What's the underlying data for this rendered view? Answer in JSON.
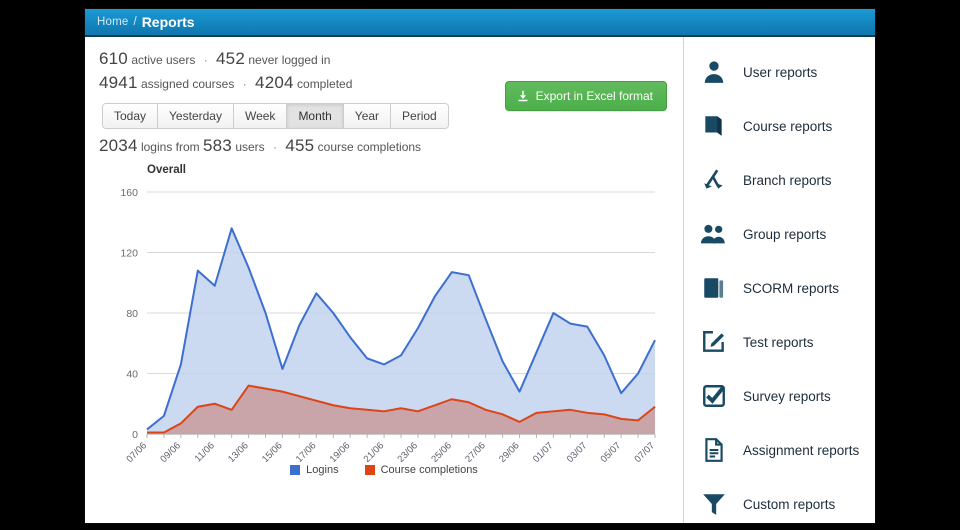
{
  "breadcrumb": {
    "home": "Home",
    "separator": "/",
    "current": "Reports"
  },
  "stats": {
    "line1": {
      "n1": "610",
      "t1": "active users",
      "sep": "·",
      "n2": "452",
      "t2": "never logged in"
    },
    "line2": {
      "n1": "4941",
      "t1": "assigned courses",
      "sep": "·",
      "n2": "4204",
      "t2": "completed"
    },
    "line3": {
      "n1": "2034",
      "t1": "logins from",
      "n2": "583",
      "t2": "users",
      "sep": "·",
      "n3": "455",
      "t3": "course completions"
    }
  },
  "export_button": {
    "label": "Export in Excel format",
    "icon": "download-icon",
    "color": "#4caf4a"
  },
  "tabs": [
    {
      "label": "Today",
      "active": false
    },
    {
      "label": "Yesterday",
      "active": false
    },
    {
      "label": "Week",
      "active": false
    },
    {
      "label": "Month",
      "active": true
    },
    {
      "label": "Year",
      "active": false
    },
    {
      "label": "Period",
      "active": false
    }
  ],
  "sidebar": {
    "items": [
      {
        "label": "User reports",
        "icon": "user-icon"
      },
      {
        "label": "Course reports",
        "icon": "book-icon"
      },
      {
        "label": "Branch reports",
        "icon": "branch-icon"
      },
      {
        "label": "Group reports",
        "icon": "users-group-icon"
      },
      {
        "label": "SCORM reports",
        "icon": "scorm-stack-icon"
      },
      {
        "label": "Test reports",
        "icon": "pencil-square-icon"
      },
      {
        "label": "Survey reports",
        "icon": "check-square-icon"
      },
      {
        "label": "Assignment reports",
        "icon": "document-icon"
      },
      {
        "label": "Custom reports",
        "icon": "funnel-icon"
      }
    ]
  },
  "chart_data": {
    "type": "area",
    "title": "Overall",
    "xlabel": "",
    "ylabel": "",
    "ylim": [
      0,
      160
    ],
    "yticks": [
      0,
      40,
      80,
      120,
      160
    ],
    "grid": true,
    "legend_position": "bottom",
    "x": [
      "07/06",
      "08/06",
      "09/06",
      "10/06",
      "11/06",
      "12/06",
      "13/06",
      "14/06",
      "15/06",
      "16/06",
      "17/06",
      "18/06",
      "19/06",
      "20/06",
      "21/06",
      "22/06",
      "23/06",
      "24/06",
      "25/06",
      "26/06",
      "27/06",
      "28/06",
      "29/06",
      "30/06",
      "01/07",
      "02/07",
      "03/07",
      "04/07",
      "05/07",
      "06/07",
      "07/07"
    ],
    "tick_labels": [
      "07/06",
      "09/06",
      "11/06",
      "13/06",
      "15/06",
      "17/06",
      "19/06",
      "21/06",
      "23/06",
      "25/06",
      "27/06",
      "29/06",
      "01/07",
      "03/07",
      "05/07",
      "07/07"
    ],
    "series": [
      {
        "name": "Logins",
        "color": "#3c6fd0",
        "fill": "#c2d2ef",
        "values": [
          3,
          12,
          46,
          108,
          98,
          136,
          110,
          80,
          43,
          72,
          93,
          80,
          64,
          50,
          46,
          52,
          70,
          91,
          107,
          105,
          76,
          48,
          28,
          54,
          80,
          73,
          71,
          52,
          27,
          40,
          62
        ]
      },
      {
        "name": "Course completions",
        "color": "#dd4418",
        "fill": "#c99a9c",
        "values": [
          1,
          1,
          7,
          18,
          20,
          16,
          32,
          30,
          28,
          25,
          22,
          19,
          17,
          16,
          15,
          17,
          15,
          19,
          23,
          21,
          16,
          13,
          8,
          14,
          15,
          16,
          14,
          13,
          10,
          9,
          18
        ]
      }
    ]
  }
}
